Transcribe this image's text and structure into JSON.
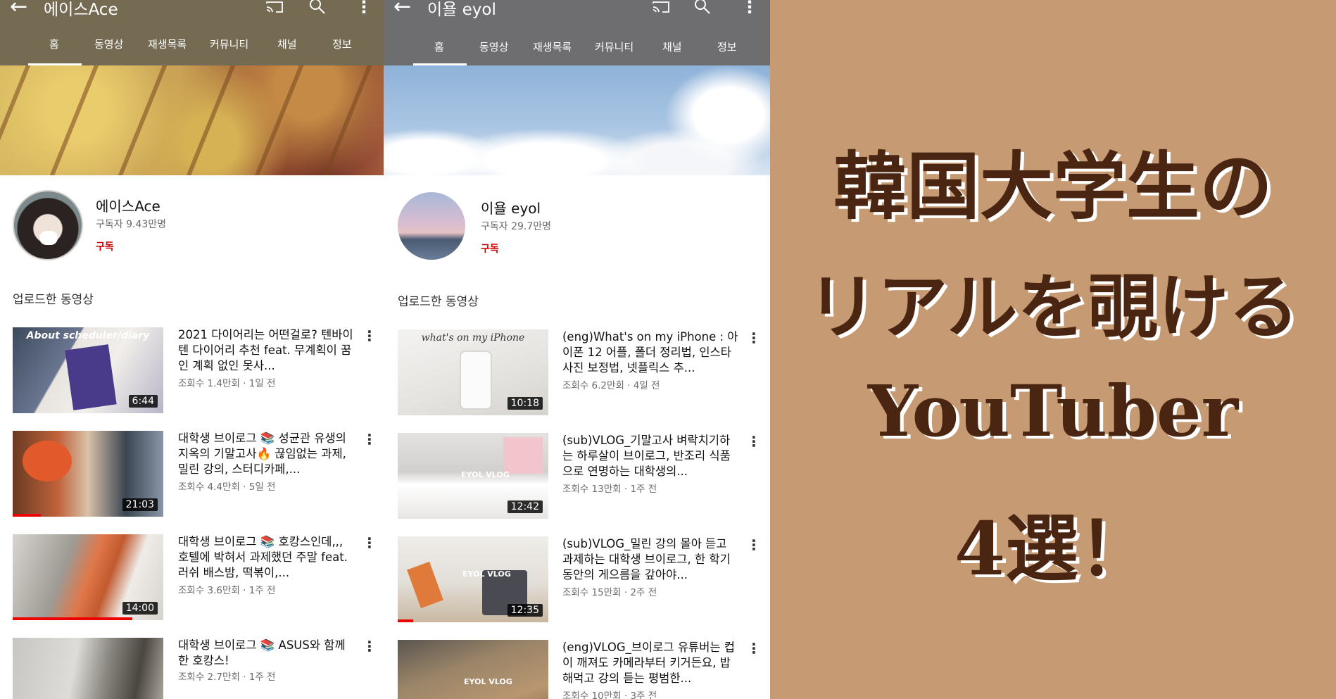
{
  "panel_a": {
    "channel_title": "에이스Ace",
    "tabs": [
      "홈",
      "동영상",
      "재생목록",
      "커뮤니티",
      "채널",
      "정보"
    ],
    "channel_name": "에이스Ace",
    "subscribers": "구독자 9.43만명",
    "subscribe": "구독",
    "section_title": "업로드한 동영상",
    "thumb_caption": "About scheduler/diary",
    "videos": [
      {
        "title": "2021 다이어리는 어떤걸로? 텐바이텐 다이어리 추천 feat. 무계획이 꿈인 계획 없인 못사...",
        "meta": "조회수 1.4만회 · 1일 전",
        "duration": "6:44"
      },
      {
        "title": "대학생 브이로그 📚 성균관 유생의 지옥의 기말고사🔥 끊임없는 과제, 밀린 강의, 스터디카페,...",
        "meta": "조회수 4.4만회 · 5일 전",
        "duration": "21:03"
      },
      {
        "title": "대학생 브이로그 📚 호캉스인데,,, 호텔에 박혀서 과제했던 주말 feat. 러쉬 배스밤, 떡볶이,...",
        "meta": "조회수 3.6만회 · 1주 전",
        "duration": "14:00"
      },
      {
        "title": "대학생 브이로그 📚 ASUS와 함께한 호캉스!",
        "meta": "조회수 2.7만회 · 1주 전",
        "duration": ""
      }
    ]
  },
  "panel_b": {
    "channel_title": "이욜 eyol",
    "tabs": [
      "홈",
      "동영상",
      "재생목록",
      "커뮤니티",
      "채널",
      "정보"
    ],
    "channel_name": "이욜 eyol",
    "subscribers": "구독자 29.7만명",
    "subscribe": "구독",
    "section_title": "업로드한 동영상",
    "thumb_caption": "what's on my iPhone",
    "thumb_mark": "EYOL VLOG",
    "videos": [
      {
        "title": "(eng)What's on my iPhone : 아이폰 12 어플, 폴더 정리법, 인스타 사진 보정법, 넷플릭스 추...",
        "meta": "조회수 6.2만회 · 4일 전",
        "duration": "10:18"
      },
      {
        "title": "(sub)VLOG_기말고사 벼락치기하는 하루살이 브이로그, 반조리 식품으로 연명하는 대학생의...",
        "meta": "조회수 13만회 · 1주 전",
        "duration": "12:42"
      },
      {
        "title": "(sub)VLOG_밀린 강의 몰아 듣고 과제하는 대학생 브이로그, 한 학기 동안의 게으름을 갚아야...",
        "meta": "조회수 15만회 · 2주 전",
        "duration": "12:35"
      },
      {
        "title": "(eng)VLOG_브이로그 유튜버는 컵이 깨져도 카메라부터 키거든요, 밥 해먹고 강의 듣는 평범한...",
        "meta": "조회수 10만회 · 3주 전",
        "duration": ""
      }
    ]
  },
  "promo": {
    "lines": [
      "韓国大学生の",
      "リアルを覗ける",
      "YouTuber",
      "4選！"
    ],
    "text_color": "#4a2612",
    "background": "#c69a72"
  },
  "icons": [
    "back-arrow-icon",
    "cast-icon",
    "search-icon",
    "more-vert-icon"
  ]
}
